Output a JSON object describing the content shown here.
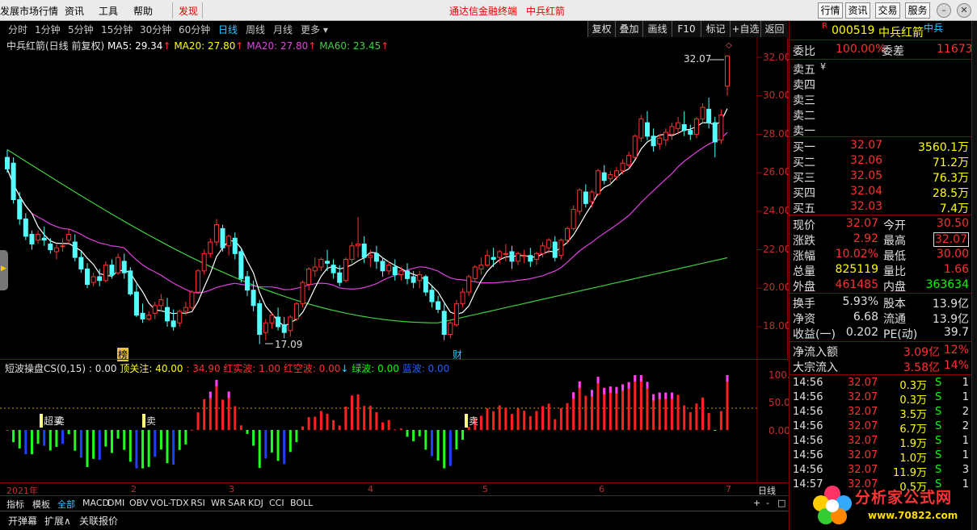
{
  "menu": {
    "items": [
      "发展市场行情",
      "资讯",
      "工具",
      "帮助",
      "发现"
    ],
    "center_title": "通达信金融终端",
    "center_stock": "中兵红箭",
    "right_buttons": [
      "行情",
      "资讯",
      "交易",
      "服务"
    ]
  },
  "periods": [
    "分时",
    "1分钟",
    "5分钟",
    "15分钟",
    "30分钟",
    "60分钟",
    "日线",
    "周线",
    "月线",
    "更多"
  ],
  "tools": [
    "复权",
    "叠加",
    "画线",
    "F10",
    "标记",
    "+自选",
    "返回"
  ],
  "info": {
    "name": "中兵红箭(日线 前复权)",
    "ma5": "MA5: 29.34",
    "ma20a": "MA20: 27.80",
    "ma20b": "MA20: 27.80",
    "ma60": "MA60: 23.45"
  },
  "price_axis": [
    "32.00",
    "30.00",
    "28.00",
    "26.00",
    "24.00",
    "22.00",
    "20.00",
    "18.00"
  ],
  "annotations": {
    "high": "32.07",
    "low": "17.09",
    "bang": "榜",
    "cai": "财"
  },
  "indicator": {
    "title": "短波操盘CS(0,15)",
    "v0": ": 0.00",
    "focus": "顶关注: 40.00",
    "v2": ": 34.90",
    "red_real": "红实波: 1.00",
    "red_empty": "红空波: 0.00",
    "green": "绿波: 0.00",
    "blue": "蓝波: 0.00",
    "axis": [
      "100.0",
      "50.00",
      "0.00"
    ],
    "sell": "超买",
    "sell2": "卖"
  },
  "time_axis": [
    "2021年",
    "2",
    "3",
    "4",
    "5",
    "6",
    "7"
  ],
  "period_label": "日线",
  "tabs": [
    "指标",
    "模板",
    "全部",
    "MACD",
    "DMI",
    "OBV",
    "VOL-TDX",
    "RSI",
    "WR",
    "SAR",
    "KDJ",
    "CCI",
    "BOLL"
  ],
  "bottom": [
    "开弹幕",
    "扩展∧",
    "关联报价"
  ],
  "stock": {
    "code": "000519",
    "name": "中兵红箭",
    "badge": "中兵",
    "r": "R"
  },
  "wei": {
    "bi_label": "委比",
    "bi": "100.00%",
    "cha_label": "委差",
    "cha": "11673"
  },
  "sells": [
    {
      "label": "卖五",
      "extra": "¥"
    },
    {
      "label": "卖四"
    },
    {
      "label": "卖三"
    },
    {
      "label": "卖二"
    },
    {
      "label": "卖一"
    }
  ],
  "buys": [
    {
      "label": "买一",
      "price": "32.07",
      "vol": "3560.1万"
    },
    {
      "label": "买二",
      "price": "32.06",
      "vol": "71.2万"
    },
    {
      "label": "买三",
      "price": "32.05",
      "vol": "76.3万"
    },
    {
      "label": "买四",
      "price": "32.04",
      "vol": "28.5万"
    },
    {
      "label": "买五",
      "price": "32.03",
      "vol": "7.4万"
    }
  ],
  "quote": [
    {
      "l1": "现价",
      "v1": "32.07",
      "l2": "今开",
      "v2": "30.50"
    },
    {
      "l1": "涨跌",
      "v1": "2.92",
      "l2": "最高",
      "v2": "32.07"
    },
    {
      "l1": "涨幅",
      "v1": "10.02%",
      "l2": "最低",
      "v2": "30.00"
    },
    {
      "l1": "总量",
      "v1": "825119",
      "l2": "量比",
      "v2": "1.66"
    },
    {
      "l1": "外盘",
      "v1": "461485",
      "l2": "内盘",
      "v2": "363634"
    }
  ],
  "quote2": [
    {
      "l1": "换手",
      "v1": "5.93%",
      "l2": "股本",
      "v2": "13.9亿"
    },
    {
      "l1": "净资",
      "v1": "6.68",
      "l2": "流通",
      "v2": "13.9亿"
    },
    {
      "l1": "收益(一)",
      "v1": "0.202",
      "l2": "PE(动)",
      "v2": "39.7"
    }
  ],
  "flow": [
    {
      "label": "净流入额",
      "v": "3.09亿",
      "p": "12%"
    },
    {
      "label": "大宗流入",
      "v": "3.58亿",
      "p": "14%"
    }
  ],
  "ticks": [
    {
      "t": "14:56",
      "p": "32.07",
      "v": "0.3万",
      "s": "S",
      "n": "1"
    },
    {
      "t": "14:56",
      "p": "32.07",
      "v": "0.3万",
      "s": "S",
      "n": "1"
    },
    {
      "t": "14:56",
      "p": "32.07",
      "v": "3.5万",
      "s": "S",
      "n": "2"
    },
    {
      "t": "14:56",
      "p": "32.07",
      "v": "6.7万",
      "s": "S",
      "n": "2"
    },
    {
      "t": "14:56",
      "p": "32.07",
      "v": "1.9万",
      "s": "S",
      "n": "1"
    },
    {
      "t": "14:56",
      "p": "32.07",
      "v": "1.0万",
      "s": "S",
      "n": "1"
    },
    {
      "t": "14:56",
      "p": "32.07",
      "v": "11.9万",
      "s": "S",
      "n": "3"
    },
    {
      "t": "14:57",
      "p": "32.07",
      "v": "0.5万",
      "s": "S",
      "n": "1"
    }
  ],
  "logo": {
    "text": "分析家公式网",
    "url": "www.70822.com"
  },
  "colors": {
    "up": "#ff3232",
    "down": "#54ffff",
    "ma5": "#ffffff",
    "ma20": "#e040e0",
    "ma60": "#40d040",
    "yellow": "#ffff00",
    "green": "#00ff00",
    "blue": "#0000ff"
  },
  "chart_data": {
    "type": "candlestick",
    "ylim": [
      16.5,
      33
    ],
    "candles": [
      [
        26.8,
        27.2,
        26.2,
        26.0
      ],
      [
        26.5,
        26.8,
        24.6,
        24.4
      ],
      [
        24.6,
        25.0,
        23.6,
        23.3
      ],
      [
        23.6,
        23.9,
        22.7,
        22.5
      ],
      [
        22.8,
        23.0,
        22.3,
        22.0
      ],
      [
        22.5,
        23.0,
        22.8,
        22.3
      ],
      [
        22.6,
        23.2,
        22.5,
        22.2
      ],
      [
        22.3,
        22.6,
        22.0,
        21.8
      ],
      [
        21.9,
        22.3,
        22.1,
        21.5
      ],
      [
        22.2,
        22.6,
        22.2,
        21.9
      ],
      [
        22.5,
        23.1,
        22.8,
        22.3
      ],
      [
        22.4,
        22.8,
        21.6,
        21.4
      ],
      [
        21.6,
        21.9,
        21.0,
        20.8
      ],
      [
        21.0,
        21.3,
        20.2,
        20.0
      ],
      [
        20.3,
        20.8,
        20.6,
        20.1
      ],
      [
        20.6,
        21.0,
        20.4,
        20.1
      ],
      [
        20.4,
        21.4,
        21.2,
        20.3
      ],
      [
        21.2,
        21.5,
        20.7,
        20.5
      ],
      [
        20.8,
        21.8,
        21.6,
        20.7
      ],
      [
        21.4,
        21.8,
        20.8,
        20.5
      ],
      [
        20.9,
        21.1,
        19.7,
        19.6
      ],
      [
        19.8,
        20.2,
        18.6,
        18.5
      ],
      [
        18.7,
        19.2,
        18.4,
        18.2
      ],
      [
        18.4,
        18.8,
        18.6,
        18.3
      ],
      [
        18.7,
        19.3,
        19.1,
        18.4
      ],
      [
        19.1,
        19.7,
        19.4,
        18.8
      ],
      [
        19.0,
        19.5,
        18.3,
        18.0
      ],
      [
        18.3,
        18.9,
        18.0,
        17.8
      ],
      [
        18.2,
        18.9,
        18.8,
        18.0
      ],
      [
        18.8,
        19.3,
        19.0,
        18.6
      ],
      [
        19.0,
        19.9,
        19.8,
        18.9
      ],
      [
        19.8,
        21.0,
        20.9,
        19.7
      ],
      [
        20.9,
        22.0,
        21.8,
        20.7
      ],
      [
        21.8,
        22.6,
        22.4,
        21.6
      ],
      [
        22.4,
        23.6,
        23.3,
        22.2
      ],
      [
        23.1,
        23.3,
        22.1,
        21.9
      ],
      [
        22.2,
        22.8,
        22.7,
        21.7
      ],
      [
        22.6,
        22.9,
        21.8,
        21.5
      ],
      [
        21.9,
        22.1,
        20.5,
        20.3
      ],
      [
        20.6,
        20.9,
        19.9,
        19.6
      ],
      [
        19.9,
        20.4,
        19.1,
        18.8
      ],
      [
        19.2,
        19.4,
        17.6,
        17.1
      ],
      [
        17.7,
        18.4,
        18.2,
        17.3
      ],
      [
        18.2,
        18.7,
        18.6,
        17.9
      ],
      [
        18.5,
        19.0,
        18.0,
        17.8
      ],
      [
        18.1,
        18.5,
        17.7,
        17.4
      ],
      [
        17.8,
        18.6,
        18.5,
        17.5
      ],
      [
        18.4,
        19.3,
        19.2,
        18.3
      ],
      [
        19.2,
        20.4,
        20.3,
        19.0
      ],
      [
        20.2,
        21.1,
        21.0,
        19.9
      ],
      [
        20.9,
        21.6,
        21.1,
        20.6
      ],
      [
        21.1,
        21.6,
        21.5,
        20.9
      ],
      [
        21.4,
        22.0,
        21.3,
        20.9
      ],
      [
        21.2,
        21.5,
        20.8,
        20.5
      ],
      [
        20.8,
        21.2,
        20.3,
        20.1
      ],
      [
        20.4,
        21.6,
        21.5,
        20.3
      ],
      [
        21.5,
        22.4,
        22.2,
        21.3
      ],
      [
        22.2,
        23.7,
        22.3,
        21.6
      ],
      [
        22.3,
        22.7,
        21.6,
        21.3
      ],
      [
        21.6,
        22.0,
        21.7,
        21.1
      ],
      [
        21.8,
        22.2,
        21.4,
        21.0
      ],
      [
        21.4,
        21.6,
        20.9,
        20.6
      ],
      [
        20.9,
        21.4,
        21.2,
        20.7
      ],
      [
        21.1,
        21.5,
        20.7,
        20.4
      ],
      [
        20.7,
        21.1,
        20.9,
        20.4
      ],
      [
        20.9,
        21.3,
        20.5,
        20.2
      ],
      [
        20.6,
        20.9,
        20.3,
        20.0
      ],
      [
        20.4,
        20.9,
        20.7,
        20.0
      ],
      [
        20.6,
        20.7,
        19.8,
        19.6
      ],
      [
        19.9,
        20.1,
        19.3,
        19.0
      ],
      [
        19.3,
        19.6,
        18.9,
        18.7
      ],
      [
        18.8,
        19.2,
        17.6,
        17.3
      ],
      [
        17.6,
        18.3,
        18.2,
        17.4
      ],
      [
        18.1,
        19.4,
        19.2,
        18.0
      ],
      [
        19.2,
        20.0,
        19.8,
        19.0
      ],
      [
        19.8,
        20.7,
        20.6,
        19.6
      ],
      [
        20.5,
        21.2,
        21.1,
        20.3
      ],
      [
        21.0,
        21.6,
        21.2,
        20.7
      ],
      [
        21.2,
        22.0,
        21.7,
        21.1
      ],
      [
        21.6,
        22.1,
        21.5,
        21.1
      ],
      [
        21.6,
        22.0,
        21.9,
        21.3
      ],
      [
        21.8,
        22.3,
        21.8,
        21.4
      ],
      [
        21.9,
        22.2,
        21.4,
        21.0
      ],
      [
        21.4,
        21.9,
        21.8,
        21.2
      ],
      [
        21.7,
        22.0,
        21.7,
        21.3
      ],
      [
        21.7,
        22.1,
        21.4,
        21.1
      ],
      [
        21.5,
        21.9,
        21.8,
        21.2
      ],
      [
        21.8,
        22.4,
        22.2,
        21.6
      ],
      [
        22.1,
        22.6,
        22.5,
        21.8
      ],
      [
        22.4,
        22.7,
        21.6,
        21.4
      ],
      [
        21.7,
        22.6,
        22.5,
        21.5
      ],
      [
        22.5,
        23.2,
        23.1,
        22.3
      ],
      [
        23.1,
        24.3,
        24.1,
        23.0
      ],
      [
        24.0,
        25.2,
        25.1,
        23.8
      ],
      [
        25.0,
        25.4,
        24.4,
        24.2
      ],
      [
        24.5,
        25.1,
        25.0,
        24.2
      ],
      [
        24.9,
        26.2,
        26.1,
        24.8
      ],
      [
        26.0,
        26.4,
        25.6,
        25.4
      ],
      [
        25.7,
        26.1,
        25.9,
        25.4
      ],
      [
        25.8,
        26.3,
        26.1,
        25.6
      ],
      [
        26.1,
        26.7,
        26.5,
        25.9
      ],
      [
        26.4,
        27.1,
        26.9,
        26.2
      ],
      [
        26.8,
        28.0,
        27.9,
        26.7
      ],
      [
        27.8,
        29.0,
        28.8,
        27.6
      ],
      [
        28.6,
        29.2,
        27.9,
        27.7
      ],
      [
        27.9,
        28.3,
        27.4,
        27.1
      ],
      [
        27.5,
        28.0,
        27.8,
        27.2
      ],
      [
        27.7,
        28.3,
        28.1,
        27.4
      ],
      [
        28.0,
        28.6,
        28.4,
        27.7
      ],
      [
        28.3,
        28.9,
        28.6,
        28.0
      ],
      [
        28.5,
        29.2,
        28.2,
        27.9
      ],
      [
        28.2,
        28.5,
        28.0,
        27.7
      ],
      [
        28.0,
        28.9,
        28.8,
        27.8
      ],
      [
        28.8,
        29.6,
        29.4,
        28.6
      ],
      [
        29.3,
        29.9,
        28.6,
        28.3
      ],
      [
        28.6,
        28.9,
        27.6,
        26.8
      ],
      [
        27.7,
        29.3,
        29.0,
        27.5
      ],
      [
        30.5,
        32.1,
        32.07,
        30.0
      ]
    ]
  }
}
